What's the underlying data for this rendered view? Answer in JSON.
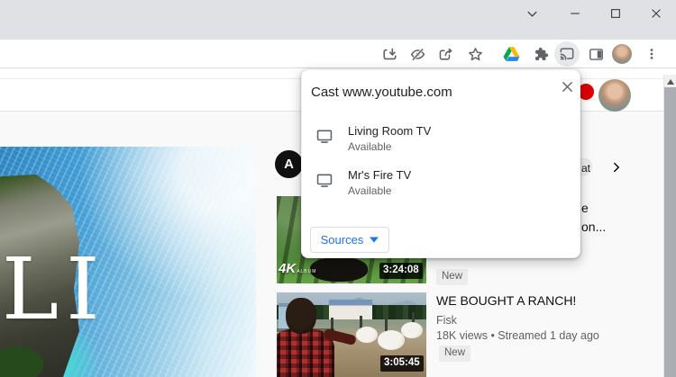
{
  "window_controls": {
    "items": [
      "chevron-down",
      "minimize",
      "maximize",
      "close"
    ]
  },
  "toolbar": {
    "icons": [
      "download",
      "visibility-off",
      "share",
      "bookmark-star",
      "google-drive",
      "extensions",
      "cast",
      "side-panel",
      "profile-avatar",
      "menu"
    ]
  },
  "cast_dialog": {
    "title": "Cast www.youtube.com",
    "devices": [
      {
        "name": "Living Room TV",
        "status": "Available"
      },
      {
        "name": "Mr's Fire TV",
        "status": "Available"
      }
    ],
    "sources_label": "Sources"
  },
  "youtube": {
    "channel_avatar_letter": "A",
    "hero_caption": "LI",
    "chip_fragment": "at",
    "videos": [
      {
        "duration": "3:24:08",
        "badge": "New",
        "watermark": "4K",
        "watermark_sub": "ALBUM",
        "title_fragment_line1": "e",
        "title_fragment_line2": "on..."
      },
      {
        "title": "WE BOUGHT A RANCH!",
        "channel": "Fisk",
        "meta": "18K views • Streamed 1 day ago",
        "badge": "New",
        "duration": "3:05:45"
      }
    ]
  },
  "colors": {
    "accent_blue": "#1a73e8",
    "titlebar_bg": "#dfe1e5",
    "notification_red": "#dd0202",
    "page_bg": "#f9f9f9",
    "icon_gray": "#5f6368"
  }
}
